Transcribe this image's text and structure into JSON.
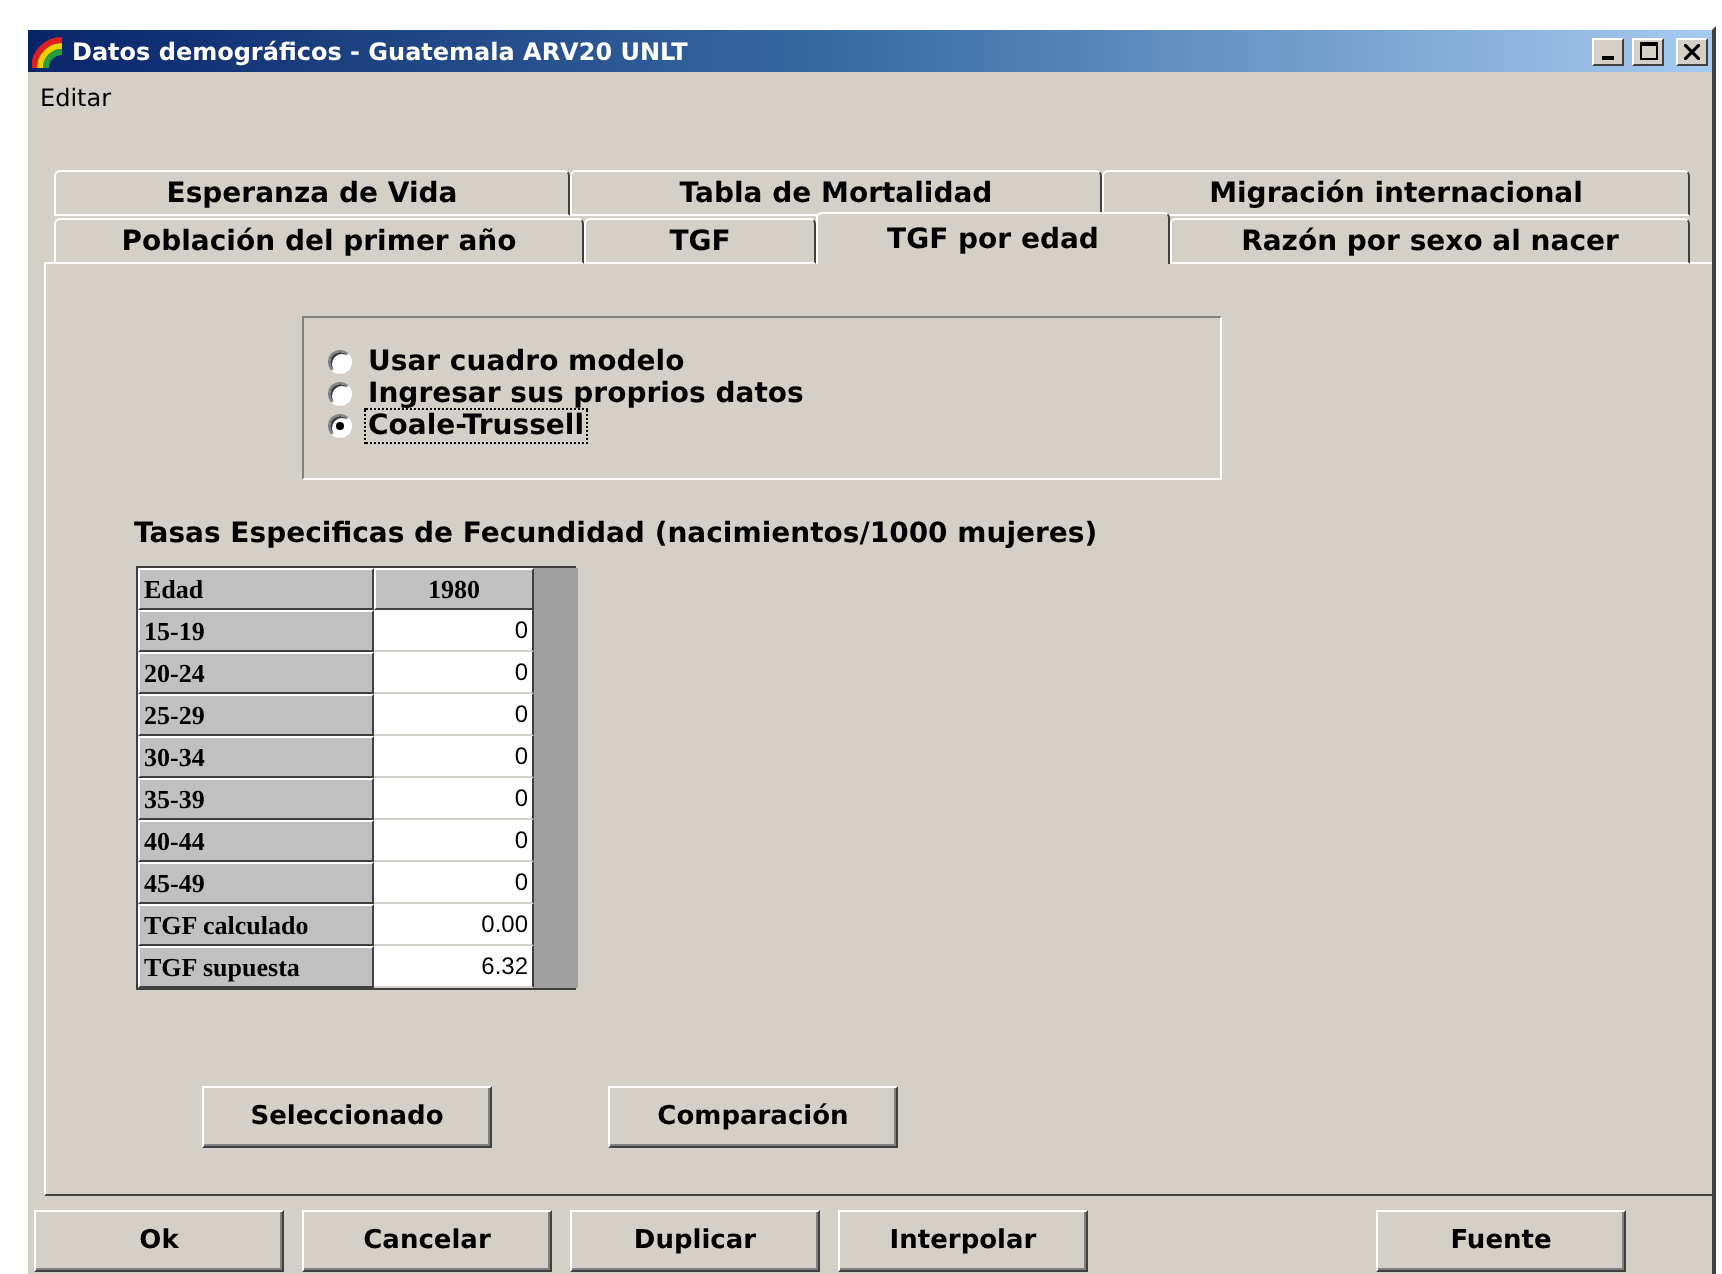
{
  "window": {
    "title": "Datos demográficos - Guatemala ARV20 UNLT"
  },
  "menu": [
    "Editar"
  ],
  "tab_rows": [
    [
      {
        "label": "Esperanza de Vida",
        "selected": false
      },
      {
        "label": "Tabla de Mortalidad",
        "selected": false
      },
      {
        "label": "Migración internacional",
        "selected": false
      }
    ],
    [
      {
        "label": "Población del primer año",
        "selected": false
      },
      {
        "label": "TGF",
        "selected": false
      },
      {
        "label": "TGF por edad",
        "selected": true
      },
      {
        "label": "Razón por sexo al nacer",
        "selected": false
      }
    ]
  ],
  "options": [
    {
      "label": "Usar cuadro modelo",
      "selected": false
    },
    {
      "label": "Ingresar sus proprios datos",
      "selected": false
    },
    {
      "label": "Coale-Trussell",
      "selected": true
    }
  ],
  "table": {
    "title": "Tasas Especificas de Fecundidad (nacimientos/1000 mujeres)",
    "columns": [
      "Edad",
      "1980"
    ],
    "rows": [
      {
        "label": "15-19",
        "value": "0"
      },
      {
        "label": "20-24",
        "value": "0"
      },
      {
        "label": "25-29",
        "value": "0"
      },
      {
        "label": "30-34",
        "value": "0"
      },
      {
        "label": "35-39",
        "value": "0"
      },
      {
        "label": "40-44",
        "value": "0"
      },
      {
        "label": "45-49",
        "value": "0"
      },
      {
        "label": "TGF calculado",
        "value": "0.00"
      },
      {
        "label": "TGF supuesta",
        "value": "6.32"
      }
    ]
  },
  "panel_buttons": [
    "Seleccionado",
    "Comparación"
  ],
  "buttons": [
    "Ok",
    "Cancelar",
    "Duplicar",
    "Interpolar"
  ],
  "side_buttons": [
    "Fuente"
  ]
}
